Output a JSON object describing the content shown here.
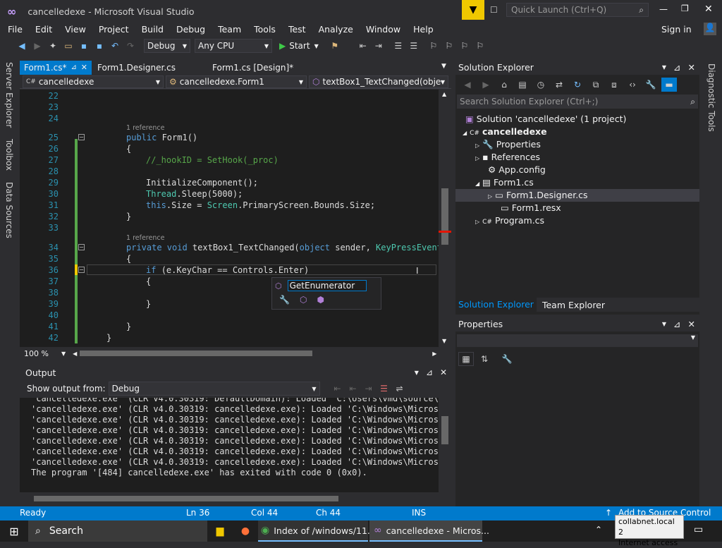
{
  "window": {
    "title": "cancelledexe - Microsoft Visual Studio",
    "quick_launch": "Quick Launch (Ctrl+Q)",
    "sign_in": "Sign in"
  },
  "menu": [
    "File",
    "Edit",
    "View",
    "Project",
    "Build",
    "Debug",
    "Team",
    "Tools",
    "Test",
    "Analyze",
    "Window",
    "Help"
  ],
  "toolbar": {
    "config": "Debug",
    "platform": "Any CPU",
    "start": "Start"
  },
  "side_tabs": [
    "Server Explorer",
    "Toolbox",
    "Data Sources"
  ],
  "doc_tabs": [
    "Form1.cs*",
    "Form1.Designer.cs",
    "Form1.cs [Design]*"
  ],
  "nav": [
    "cancelledexe",
    "cancelledexe.Form1",
    "textBox1_TextChanged(object s"
  ],
  "code_lines": [
    {
      "n": "22",
      "t": ""
    },
    {
      "n": "23",
      "t": ""
    },
    {
      "n": "24",
      "t": ""
    },
    {
      "n": "25",
      "t": "public Form1()"
    },
    {
      "n": "26",
      "t": "{"
    },
    {
      "n": "27",
      "t": "//_hookID = SetHook(_proc)"
    },
    {
      "n": "28",
      "t": ""
    },
    {
      "n": "29",
      "t": "InitializeComponent();"
    },
    {
      "n": "30",
      "t": "Thread.Sleep(5000);"
    },
    {
      "n": "31",
      "t": "this.Size = Screen.PrimaryScreen.Bounds.Size;"
    },
    {
      "n": "32",
      "t": "}"
    },
    {
      "n": "33",
      "t": ""
    },
    {
      "n": "34",
      "t": "private void textBox1_TextChanged(object sender, KeyPressEventA"
    },
    {
      "n": "35",
      "t": "{"
    },
    {
      "n": "36",
      "t": "if (e.KeyChar == Controls.Enter)"
    },
    {
      "n": "37",
      "t": "{"
    },
    {
      "n": "38",
      "t": ""
    },
    {
      "n": "39",
      "t": "}"
    },
    {
      "n": "40",
      "t": ""
    },
    {
      "n": "41",
      "t": "}"
    },
    {
      "n": "42",
      "t": "}"
    }
  ],
  "ref_label": "1 reference",
  "intellisense": "GetEnumerator",
  "zoom": "100 %",
  "solution_explorer": {
    "title": "Solution Explorer",
    "search": "Search Solution Explorer (Ctrl+;)",
    "items": [
      "Solution 'cancelledexe' (1 project)",
      "cancelledexe",
      "Properties",
      "References",
      "App.config",
      "Form1.cs",
      "Form1.Designer.cs",
      "Form1.resx",
      "Program.cs"
    ],
    "tabs": [
      "Solution Explorer",
      "Team Explorer"
    ]
  },
  "properties": {
    "title": "Properties"
  },
  "output": {
    "title": "Output",
    "show_from": "Show output from:",
    "source": "Debug",
    "lines": [
      "'cancelledexe.exe' (CLR v4.0.30319: DefaultDomain): Loaded 'C:\\Users\\vmd\\source\\rep",
      "'cancelledexe.exe' (CLR v4.0.30319: cancelledexe.exe): Loaded 'C:\\Windows\\Microsoft",
      "'cancelledexe.exe' (CLR v4.0.30319: cancelledexe.exe): Loaded 'C:\\Windows\\Microsoft",
      "'cancelledexe.exe' (CLR v4.0.30319: cancelledexe.exe): Loaded 'C:\\Windows\\Microsoft",
      "'cancelledexe.exe' (CLR v4.0.30319: cancelledexe.exe): Loaded 'C:\\Windows\\Microsoft",
      "'cancelledexe.exe' (CLR v4.0.30319: cancelledexe.exe): Loaded 'C:\\Windows\\Microsoft",
      "'cancelledexe.exe' (CLR v4.0.30319: cancelledexe.exe): Loaded 'C:\\Windows\\Microsoft",
      "The program '[484] cancelledexe.exe' has exited with code 0 (0x0)."
    ]
  },
  "status": {
    "ready": "Ready",
    "ln": "Ln 36",
    "col": "Col 44",
    "ch": "Ch 44",
    "ins": "INS",
    "source_control": "Add to Source Control"
  },
  "diag_tab": "Diagnostic Tools",
  "taskbar": {
    "search": "Search",
    "chrome": "Index of /windows/11...",
    "vs": "cancelledexe - Micros...",
    "tooltip1": "collabnet.local 2",
    "tooltip2": "Internet access"
  }
}
